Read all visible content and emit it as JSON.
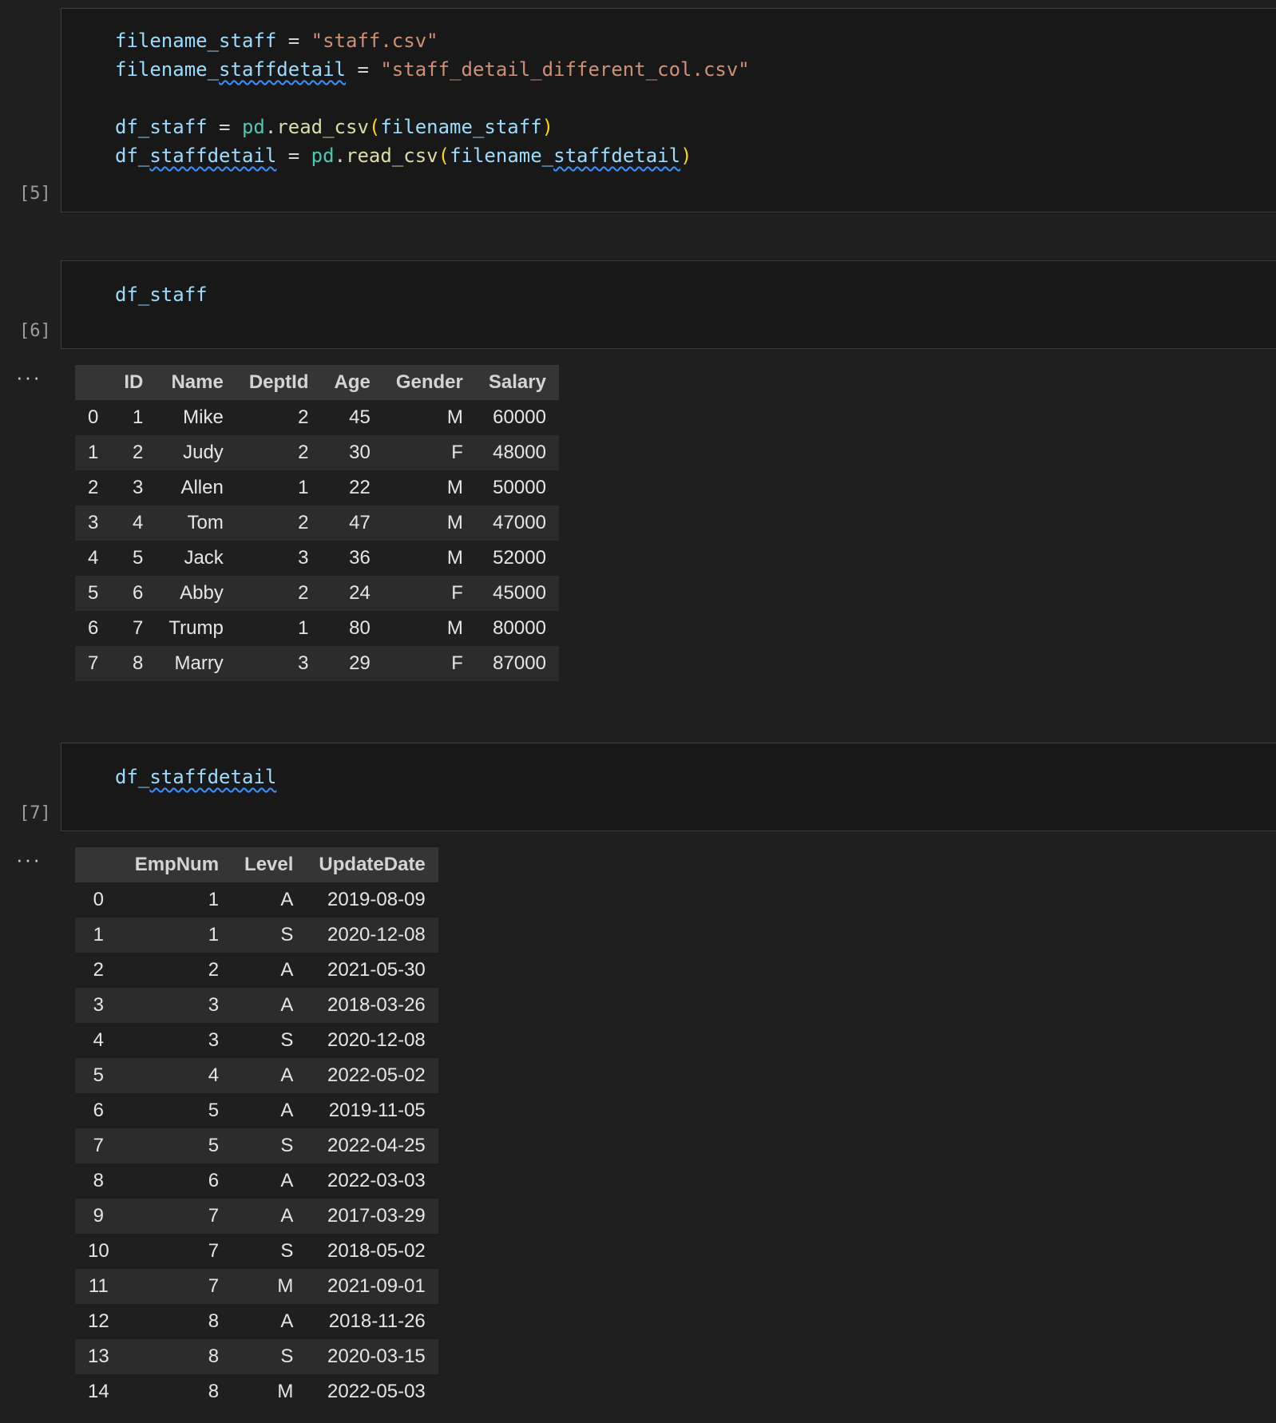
{
  "cells": {
    "c5": {
      "exec_count": "[5]",
      "code": {
        "l1": {
          "var": "filename_staff",
          "op": " = ",
          "str": "\"staff.csv\""
        },
        "l2": {
          "var_a": "filename_",
          "var_b": "staffdetail",
          "op": " = ",
          "str": "\"staff_detail_different_col.csv\""
        },
        "l3": {
          "var": "df_staff",
          "op": " = ",
          "mod": "pd",
          "dot": ".",
          "fn": "read_csv",
          "po": "(",
          "arg": "filename_staff",
          "pc": ")"
        },
        "l4": {
          "var_a": "df_",
          "var_b": "staffdetail",
          "op": " = ",
          "mod": "pd",
          "dot": ".",
          "fn": "read_csv",
          "po": "(",
          "arg_a": "filename_",
          "arg_b": "staffdetail",
          "pc": ")"
        }
      }
    },
    "c6": {
      "exec_count": "[6]",
      "code": {
        "l1": "df_staff"
      },
      "output_ellipsis": "···"
    },
    "c7": {
      "exec_count": "[7]",
      "code": {
        "l1_a": "df_",
        "l1_b": "staffdetail"
      },
      "output_ellipsis": "···"
    }
  },
  "df_staff": {
    "columns": [
      "",
      "ID",
      "Name",
      "DeptId",
      "Age",
      "Gender",
      "Salary"
    ],
    "rows": [
      [
        "0",
        "1",
        "Mike",
        "2",
        "45",
        "M",
        "60000"
      ],
      [
        "1",
        "2",
        "Judy",
        "2",
        "30",
        "F",
        "48000"
      ],
      [
        "2",
        "3",
        "Allen",
        "1",
        "22",
        "M",
        "50000"
      ],
      [
        "3",
        "4",
        "Tom",
        "2",
        "47",
        "M",
        "47000"
      ],
      [
        "4",
        "5",
        "Jack",
        "3",
        "36",
        "M",
        "52000"
      ],
      [
        "5",
        "6",
        "Abby",
        "2",
        "24",
        "F",
        "45000"
      ],
      [
        "6",
        "7",
        "Trump",
        "1",
        "80",
        "M",
        "80000"
      ],
      [
        "7",
        "8",
        "Marry",
        "3",
        "29",
        "F",
        "87000"
      ]
    ]
  },
  "df_staffdetail": {
    "columns": [
      "",
      "EmpNum",
      "Level",
      "UpdateDate"
    ],
    "rows": [
      [
        "0",
        "1",
        "A",
        "2019-08-09"
      ],
      [
        "1",
        "1",
        "S",
        "2020-12-08"
      ],
      [
        "2",
        "2",
        "A",
        "2021-05-30"
      ],
      [
        "3",
        "3",
        "A",
        "2018-03-26"
      ],
      [
        "4",
        "3",
        "S",
        "2020-12-08"
      ],
      [
        "5",
        "4",
        "A",
        "2022-05-02"
      ],
      [
        "6",
        "5",
        "A",
        "2019-11-05"
      ],
      [
        "7",
        "5",
        "S",
        "2022-04-25"
      ],
      [
        "8",
        "6",
        "A",
        "2022-03-03"
      ],
      [
        "9",
        "7",
        "A",
        "2017-03-29"
      ],
      [
        "10",
        "7",
        "S",
        "2018-05-02"
      ],
      [
        "11",
        "7",
        "M",
        "2021-09-01"
      ],
      [
        "12",
        "8",
        "A",
        "2018-11-26"
      ],
      [
        "13",
        "8",
        "S",
        "2020-03-15"
      ],
      [
        "14",
        "8",
        "M",
        "2022-05-03"
      ]
    ]
  },
  "colors": {
    "background": "#1f1f1f",
    "cell_background": "#181818",
    "variable": "#9cdcfe",
    "string": "#ce9178",
    "function": "#dcdcaa",
    "module": "#4ec9b0",
    "bracket": "#ffd700",
    "squiggle": "#3794ff"
  }
}
